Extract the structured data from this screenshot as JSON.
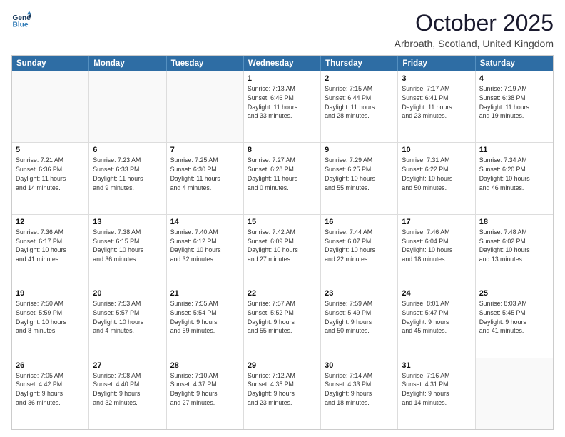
{
  "header": {
    "logo_line1": "General",
    "logo_line2": "Blue",
    "month": "October 2025",
    "location": "Arbroath, Scotland, United Kingdom"
  },
  "days_of_week": [
    "Sunday",
    "Monday",
    "Tuesday",
    "Wednesday",
    "Thursday",
    "Friday",
    "Saturday"
  ],
  "weeks": [
    [
      {
        "day": "",
        "info": ""
      },
      {
        "day": "",
        "info": ""
      },
      {
        "day": "",
        "info": ""
      },
      {
        "day": "1",
        "info": "Sunrise: 7:13 AM\nSunset: 6:46 PM\nDaylight: 11 hours\nand 33 minutes."
      },
      {
        "day": "2",
        "info": "Sunrise: 7:15 AM\nSunset: 6:44 PM\nDaylight: 11 hours\nand 28 minutes."
      },
      {
        "day": "3",
        "info": "Sunrise: 7:17 AM\nSunset: 6:41 PM\nDaylight: 11 hours\nand 23 minutes."
      },
      {
        "day": "4",
        "info": "Sunrise: 7:19 AM\nSunset: 6:38 PM\nDaylight: 11 hours\nand 19 minutes."
      }
    ],
    [
      {
        "day": "5",
        "info": "Sunrise: 7:21 AM\nSunset: 6:36 PM\nDaylight: 11 hours\nand 14 minutes."
      },
      {
        "day": "6",
        "info": "Sunrise: 7:23 AM\nSunset: 6:33 PM\nDaylight: 11 hours\nand 9 minutes."
      },
      {
        "day": "7",
        "info": "Sunrise: 7:25 AM\nSunset: 6:30 PM\nDaylight: 11 hours\nand 4 minutes."
      },
      {
        "day": "8",
        "info": "Sunrise: 7:27 AM\nSunset: 6:28 PM\nDaylight: 11 hours\nand 0 minutes."
      },
      {
        "day": "9",
        "info": "Sunrise: 7:29 AM\nSunset: 6:25 PM\nDaylight: 10 hours\nand 55 minutes."
      },
      {
        "day": "10",
        "info": "Sunrise: 7:31 AM\nSunset: 6:22 PM\nDaylight: 10 hours\nand 50 minutes."
      },
      {
        "day": "11",
        "info": "Sunrise: 7:34 AM\nSunset: 6:20 PM\nDaylight: 10 hours\nand 46 minutes."
      }
    ],
    [
      {
        "day": "12",
        "info": "Sunrise: 7:36 AM\nSunset: 6:17 PM\nDaylight: 10 hours\nand 41 minutes."
      },
      {
        "day": "13",
        "info": "Sunrise: 7:38 AM\nSunset: 6:15 PM\nDaylight: 10 hours\nand 36 minutes."
      },
      {
        "day": "14",
        "info": "Sunrise: 7:40 AM\nSunset: 6:12 PM\nDaylight: 10 hours\nand 32 minutes."
      },
      {
        "day": "15",
        "info": "Sunrise: 7:42 AM\nSunset: 6:09 PM\nDaylight: 10 hours\nand 27 minutes."
      },
      {
        "day": "16",
        "info": "Sunrise: 7:44 AM\nSunset: 6:07 PM\nDaylight: 10 hours\nand 22 minutes."
      },
      {
        "day": "17",
        "info": "Sunrise: 7:46 AM\nSunset: 6:04 PM\nDaylight: 10 hours\nand 18 minutes."
      },
      {
        "day": "18",
        "info": "Sunrise: 7:48 AM\nSunset: 6:02 PM\nDaylight: 10 hours\nand 13 minutes."
      }
    ],
    [
      {
        "day": "19",
        "info": "Sunrise: 7:50 AM\nSunset: 5:59 PM\nDaylight: 10 hours\nand 8 minutes."
      },
      {
        "day": "20",
        "info": "Sunrise: 7:53 AM\nSunset: 5:57 PM\nDaylight: 10 hours\nand 4 minutes."
      },
      {
        "day": "21",
        "info": "Sunrise: 7:55 AM\nSunset: 5:54 PM\nDaylight: 9 hours\nand 59 minutes."
      },
      {
        "day": "22",
        "info": "Sunrise: 7:57 AM\nSunset: 5:52 PM\nDaylight: 9 hours\nand 55 minutes."
      },
      {
        "day": "23",
        "info": "Sunrise: 7:59 AM\nSunset: 5:49 PM\nDaylight: 9 hours\nand 50 minutes."
      },
      {
        "day": "24",
        "info": "Sunrise: 8:01 AM\nSunset: 5:47 PM\nDaylight: 9 hours\nand 45 minutes."
      },
      {
        "day": "25",
        "info": "Sunrise: 8:03 AM\nSunset: 5:45 PM\nDaylight: 9 hours\nand 41 minutes."
      }
    ],
    [
      {
        "day": "26",
        "info": "Sunrise: 7:05 AM\nSunset: 4:42 PM\nDaylight: 9 hours\nand 36 minutes."
      },
      {
        "day": "27",
        "info": "Sunrise: 7:08 AM\nSunset: 4:40 PM\nDaylight: 9 hours\nand 32 minutes."
      },
      {
        "day": "28",
        "info": "Sunrise: 7:10 AM\nSunset: 4:37 PM\nDaylight: 9 hours\nand 27 minutes."
      },
      {
        "day": "29",
        "info": "Sunrise: 7:12 AM\nSunset: 4:35 PM\nDaylight: 9 hours\nand 23 minutes."
      },
      {
        "day": "30",
        "info": "Sunrise: 7:14 AM\nSunset: 4:33 PM\nDaylight: 9 hours\nand 18 minutes."
      },
      {
        "day": "31",
        "info": "Sunrise: 7:16 AM\nSunset: 4:31 PM\nDaylight: 9 hours\nand 14 minutes."
      },
      {
        "day": "",
        "info": ""
      }
    ]
  ]
}
